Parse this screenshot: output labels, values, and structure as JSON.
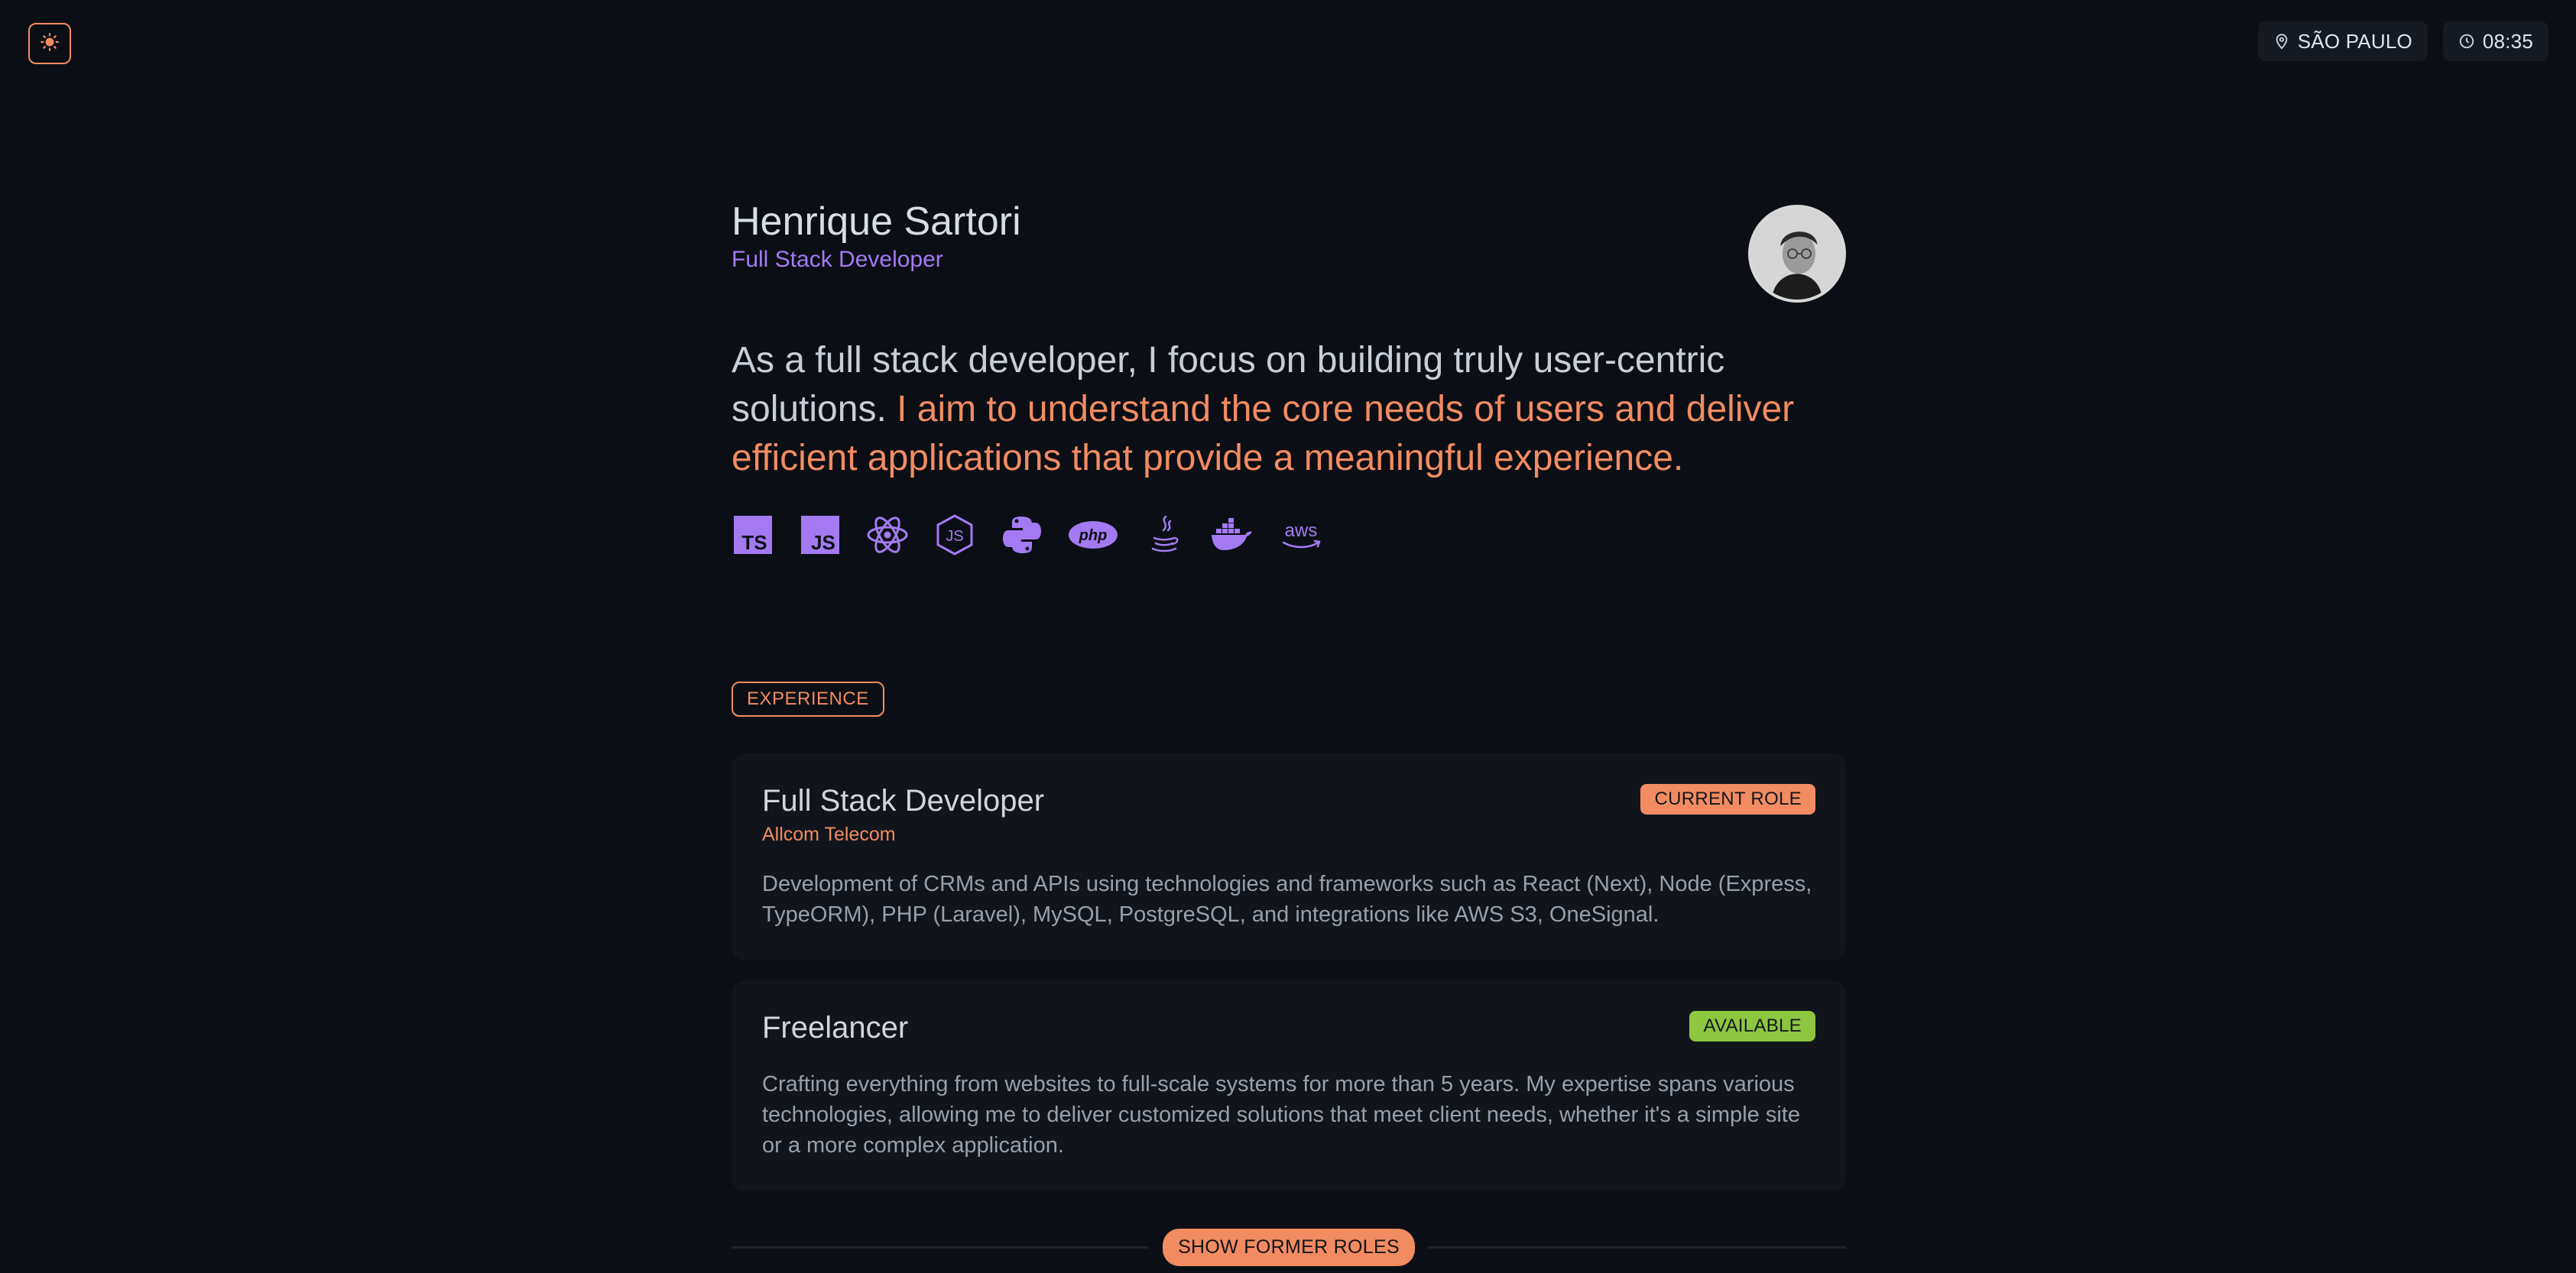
{
  "theme_toggle": {
    "icon": "sun-icon"
  },
  "location": {
    "label": "SÃO PAULO",
    "icon": "map-pin-icon"
  },
  "clock": {
    "time": "08:35",
    "icon": "clock-icon"
  },
  "profile": {
    "name": "Henrique Sartori",
    "role": "Full Stack Developer",
    "avatar_icon": "avatar-photo"
  },
  "intro": {
    "plain": "As a full stack developer, I focus on building truly user-centric solutions. ",
    "highlight": "I aim to understand the core needs of users and deliver efficient applications that provide a meaningful experience."
  },
  "tech_stack": [
    "typescript-icon",
    "javascript-icon",
    "react-icon",
    "nodejs-icon",
    "python-icon",
    "php-icon",
    "java-icon",
    "docker-icon",
    "aws-icon"
  ],
  "experience": {
    "section_label": "EXPERIENCE",
    "roles": [
      {
        "title": "Full Stack Developer",
        "company": "Allcom Telecom",
        "badge": "CURRENT ROLE",
        "description": "Development of CRMs and APIs using technologies and frameworks such as React (Next), Node (Express, TypeORM), PHP (Laravel), MySQL, PostgreSQL, and integrations like AWS S3, OneSignal."
      },
      {
        "title": "Freelancer",
        "badge": "AVAILABLE",
        "description": "Crafting everything from websites to full-scale systems for more than 5 years. My expertise spans various technologies, allowing me to deliver customized solutions that meet client needs, whether it's a simple site or a more complex application."
      }
    ],
    "show_former": "SHOW FORMER ROLES"
  },
  "colors": {
    "background": "#0b0f15",
    "card": "#11151b",
    "accent": "#f28b62",
    "purple": "#a37af2",
    "green": "#8dc63f"
  }
}
